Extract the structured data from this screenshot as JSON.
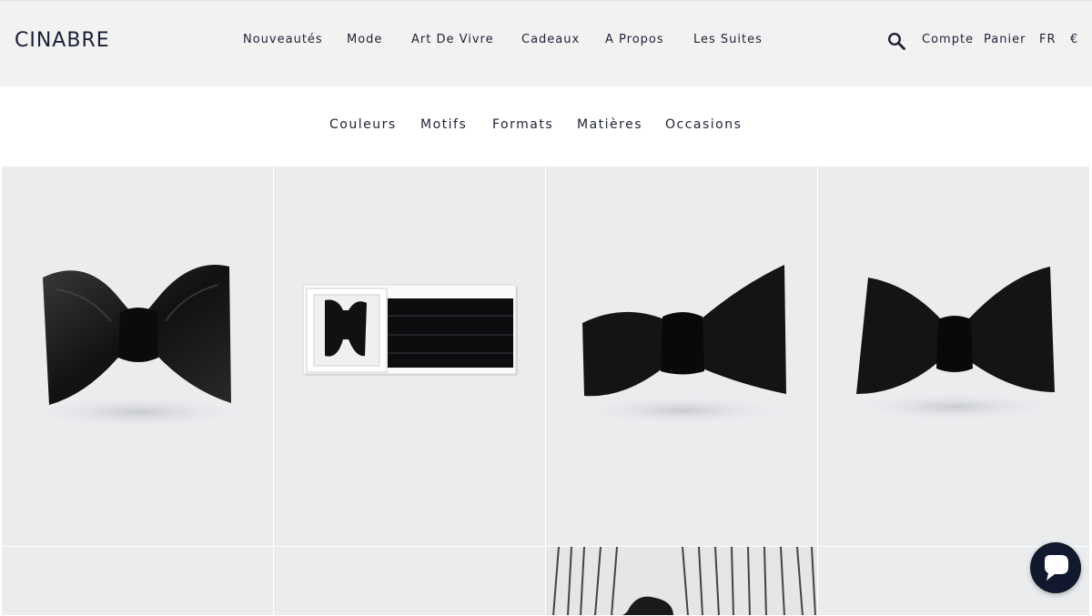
{
  "brand": {
    "logo": "CINABRE"
  },
  "nav": {
    "items": [
      "Nouveautés",
      "Mode",
      "Art De Vivre",
      "Cadeaux",
      "A Propos",
      "Les Suites"
    ]
  },
  "utility": {
    "search_icon": "search-icon",
    "account": "Compte",
    "cart": "Panier",
    "language": "FR",
    "currency": "€"
  },
  "filters": {
    "items": [
      "Couleurs",
      "Motifs",
      "Formats",
      "Matières",
      "Occasions"
    ]
  },
  "products": [
    {
      "image": "black-satin-bow-tie"
    },
    {
      "image": "bow-tie-and-cummerbund-gift-box"
    },
    {
      "image": "black-velvet-bow-tie"
    },
    {
      "image": "black-velvet-bow-tie-butterfly"
    },
    {
      "image": "product-photo"
    },
    {
      "image": "product-photo"
    },
    {
      "image": "model-portrait-striped-background"
    },
    {
      "image": "product-photo"
    }
  ],
  "chat": {
    "icon": "chat-bubble-icon"
  },
  "colors": {
    "topbar": "#f2f2f2",
    "tile": "#ebecee",
    "text": "#1e2233",
    "chat": "#12182e"
  }
}
